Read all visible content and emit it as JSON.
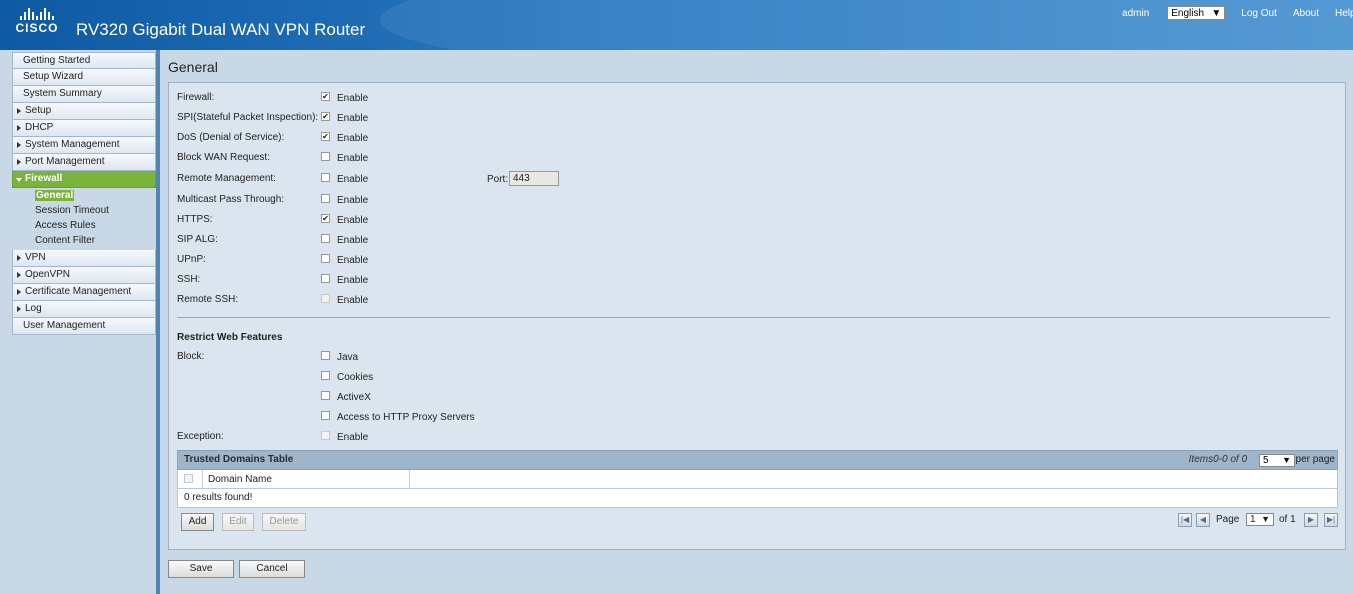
{
  "header": {
    "logo_text": "CISCO",
    "product_title": "RV320  Gigabit Dual WAN VPN Router",
    "user": "admin",
    "language": "English",
    "links": [
      "Log Out",
      "About",
      "Help"
    ]
  },
  "sidebar": {
    "items": [
      {
        "label": "Getting Started",
        "arrow": false
      },
      {
        "label": "Setup Wizard",
        "arrow": false
      },
      {
        "label": "System Summary",
        "arrow": false
      },
      {
        "label": "Setup",
        "arrow": true
      },
      {
        "label": "DHCP",
        "arrow": true
      },
      {
        "label": "System Management",
        "arrow": true
      },
      {
        "label": "Port Management",
        "arrow": true
      },
      {
        "label": "Firewall",
        "arrow": true,
        "active": true
      }
    ],
    "firewall_sub": [
      "General",
      "Session Timeout",
      "Access Rules",
      "Content Filter"
    ],
    "items_after": [
      {
        "label": "VPN",
        "arrow": true
      },
      {
        "label": "OpenVPN",
        "arrow": true
      },
      {
        "label": "Certificate Management",
        "arrow": true
      },
      {
        "label": "Log",
        "arrow": true
      },
      {
        "label": "User Management",
        "arrow": false
      }
    ]
  },
  "main": {
    "title": "General",
    "enable_label": "Enable",
    "settings": [
      {
        "label": "Firewall:",
        "checked": true
      },
      {
        "label": "SPI(Stateful Packet Inspection):",
        "checked": true
      },
      {
        "label": "DoS (Denial of Service):",
        "checked": true
      },
      {
        "label": "Block WAN Request:",
        "checked": false
      },
      {
        "label": "Remote Management:",
        "checked": false
      },
      {
        "label": "Multicast Pass Through:",
        "checked": false
      },
      {
        "label": "HTTPS:",
        "checked": true
      },
      {
        "label": "SIP ALG:",
        "checked": false
      },
      {
        "label": "UPnP:",
        "checked": false
      },
      {
        "label": "SSH:",
        "checked": false
      },
      {
        "label": "Remote SSH:",
        "checked": false,
        "disabled": true
      }
    ],
    "port_label": "Port:",
    "port_value": "443",
    "restrict_title": "Restrict Web Features",
    "block_label": "Block:",
    "block_options": [
      {
        "label": "Java",
        "checked": false
      },
      {
        "label": "Cookies",
        "checked": false
      },
      {
        "label": "ActiveX",
        "checked": false
      },
      {
        "label": "Access to HTTP Proxy Servers",
        "checked": false
      }
    ],
    "exception_label": "Exception:",
    "exception_enable": "Enable"
  },
  "trusted_table": {
    "title": "Trusted Domains Table",
    "items_text": "Items0-0 of 0",
    "per_page_value": "5",
    "per_page_label": "per page",
    "column": "Domain Name",
    "empty_text": "0 results found!",
    "buttons": {
      "add": "Add",
      "edit": "Edit",
      "delete": "Delete"
    },
    "pager": {
      "page_label": "Page",
      "page_value": "1",
      "of_label": "of 1"
    }
  },
  "footer": {
    "save": "Save",
    "cancel": "Cancel"
  }
}
